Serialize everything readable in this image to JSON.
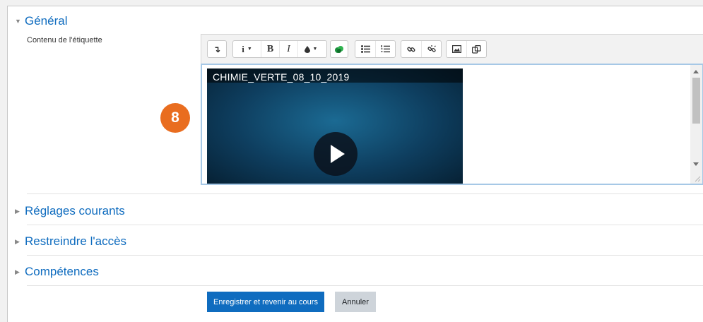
{
  "sections": {
    "general": {
      "title": "Général",
      "expanded": true
    },
    "reglages": {
      "title": "Réglages courants",
      "expanded": false
    },
    "restreindre": {
      "title": "Restreindre l'accès",
      "expanded": false
    },
    "competences": {
      "title": "Compétences",
      "expanded": false
    }
  },
  "general": {
    "field_label": "Contenu de l'étiquette"
  },
  "toolbar": {
    "toggle": "↴",
    "info": "i",
    "bold": "B",
    "italic": "I"
  },
  "video": {
    "title": "CHIMIE_VERTE_08_10_2019"
  },
  "badge": {
    "number": "8",
    "color": "#e96d1f"
  },
  "buttons": {
    "save": "Enregistrer et revenir au cours",
    "cancel": "Annuler"
  },
  "colors": {
    "accent": "#0f6cbf",
    "editor_focus_border": "#a6c8e6"
  },
  "icons": [
    "chevron-down-icon",
    "chevron-right-icon",
    "text-color-icon",
    "attach-icon",
    "unordered-list-icon",
    "ordered-list-icon",
    "link-icon",
    "unlink-icon",
    "image-icon",
    "media-icon",
    "play-icon"
  ]
}
